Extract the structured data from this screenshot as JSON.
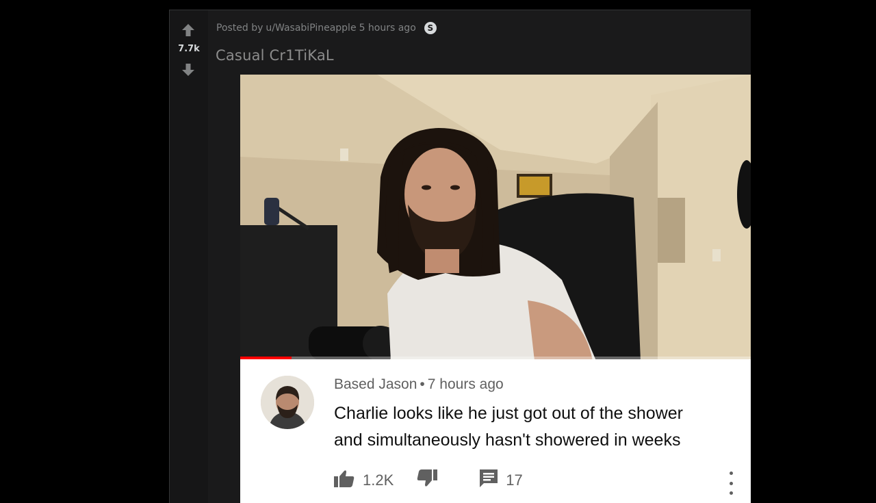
{
  "post": {
    "meta_prefix": "Posted by",
    "author": "u/WasabiPineapple",
    "age": "5 hours ago",
    "award_icon": "coin-icon",
    "award_glyph": "S",
    "votes": "7.7k",
    "title": "Casual Cr1TiKaL"
  },
  "video": {
    "progress_fraction": 0.1
  },
  "comment": {
    "author": "Based Jason",
    "separator": "•",
    "age": "7 hours ago",
    "text_lines": [
      "Charlie looks like he just got out of the shower",
      "and simultaneously hasn't showered in weeks"
    ],
    "likes": "1.2K",
    "replies": "17"
  },
  "colors": {
    "background": "#000000",
    "card": "#1a1a1b",
    "muted_text": "#818384",
    "progress": "#ff0000"
  }
}
